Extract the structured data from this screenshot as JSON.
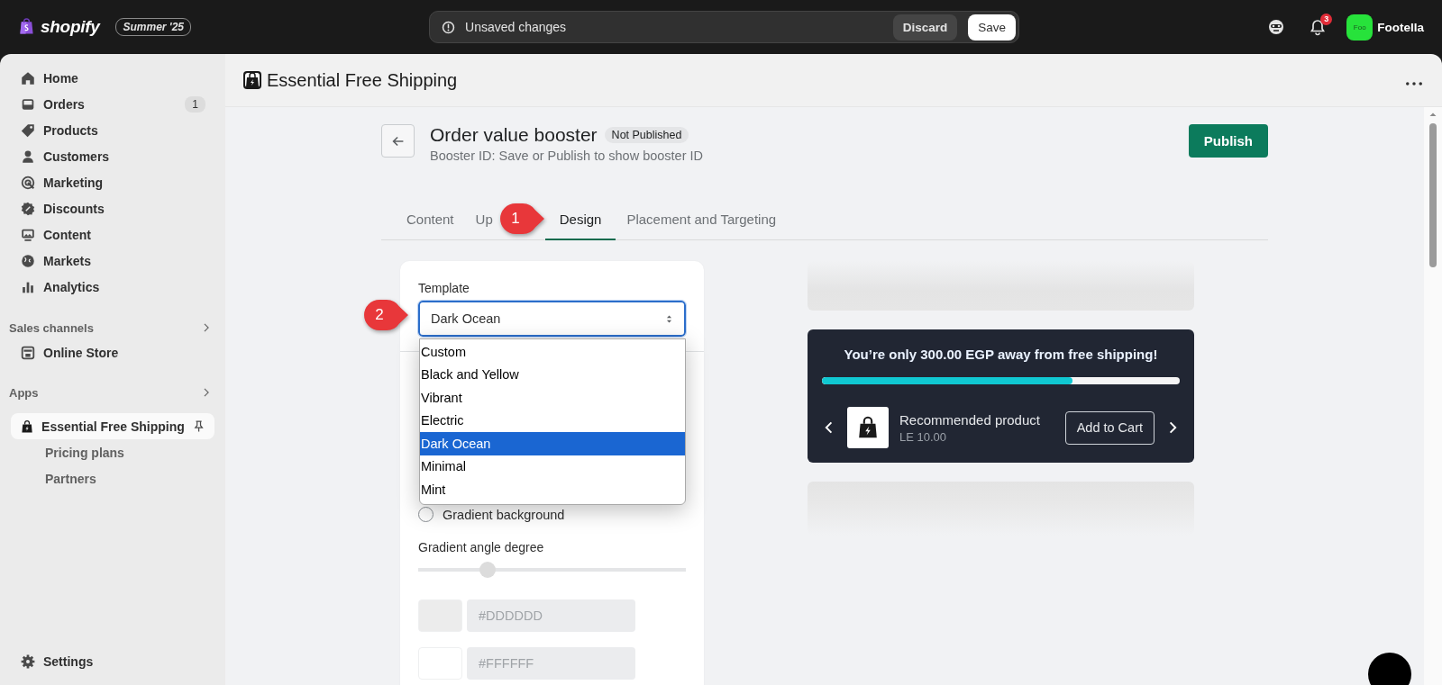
{
  "topbar": {
    "logo": "shopify",
    "edition": "Summer '25",
    "unsaved_message": "Unsaved changes",
    "discard_button": "Discard",
    "save_button": "Save",
    "notification_count": "3",
    "avatar_text": "Foo",
    "store_name": "Footella"
  },
  "sidebar": {
    "items": [
      {
        "label": "Home",
        "selected": false
      },
      {
        "label": "Orders",
        "badge": "1",
        "selected": false
      },
      {
        "label": "Products",
        "selected": false
      },
      {
        "label": "Customers",
        "selected": false
      },
      {
        "label": "Marketing",
        "selected": false
      },
      {
        "label": "Discounts",
        "selected": false
      },
      {
        "label": "Content",
        "selected": false
      },
      {
        "label": "Markets",
        "selected": false
      },
      {
        "label": "Analytics",
        "selected": false
      }
    ],
    "sales_channels": {
      "title": "Sales channels",
      "items": [
        {
          "label": "Online Store",
          "selected": false
        }
      ]
    },
    "apps": {
      "title": "Apps",
      "items": [
        {
          "label": "Essential Free Shipping",
          "selected": true,
          "pinned": true,
          "children": [
            {
              "label": "Pricing plans",
              "selected": false
            },
            {
              "label": "Partners",
              "selected": false
            }
          ]
        }
      ]
    },
    "settings": "Settings"
  },
  "app_header": {
    "title": "Essential Free Shipping"
  },
  "page": {
    "title": "Order value booster",
    "status": "Not Published",
    "subtitle": "Booster ID: Save or Publish to show booster ID",
    "publish_button": "Publish",
    "tabs": [
      {
        "label": "Content",
        "selected": false
      },
      {
        "label": "Up",
        "selected": false
      },
      {
        "label": "Design",
        "selected": true
      },
      {
        "label": "Placement and Targeting",
        "selected": false
      }
    ]
  },
  "design": {
    "template_label": "Template",
    "template_value": "Dark Ocean",
    "template_options": [
      {
        "label": "Custom",
        "selected": false
      },
      {
        "label": "Black and Yellow",
        "selected": false
      },
      {
        "label": "Vibrant",
        "selected": false
      },
      {
        "label": "Electric",
        "selected": false
      },
      {
        "label": "Dark Ocean",
        "selected": true
      },
      {
        "label": "Minimal",
        "selected": false
      },
      {
        "label": "Mint",
        "selected": false
      }
    ],
    "gradient_radio": {
      "label": "Gradient background",
      "checked": false
    },
    "angle_slider": {
      "label": "Gradient angle degree",
      "level": 0.26
    },
    "color_fields": [
      {
        "value": "#DDDDDD"
      },
      {
        "value": "#FFFFFF"
      }
    ]
  },
  "preview": {
    "message": "You’re only 300.00 EGP away from free shipping!",
    "level": 0.7,
    "product_name": "Recommended product",
    "product_price": "LE 10.00",
    "add_button": "Add to Cart"
  },
  "annotations": [
    {
      "number": "1"
    },
    {
      "number": "2"
    }
  ]
}
